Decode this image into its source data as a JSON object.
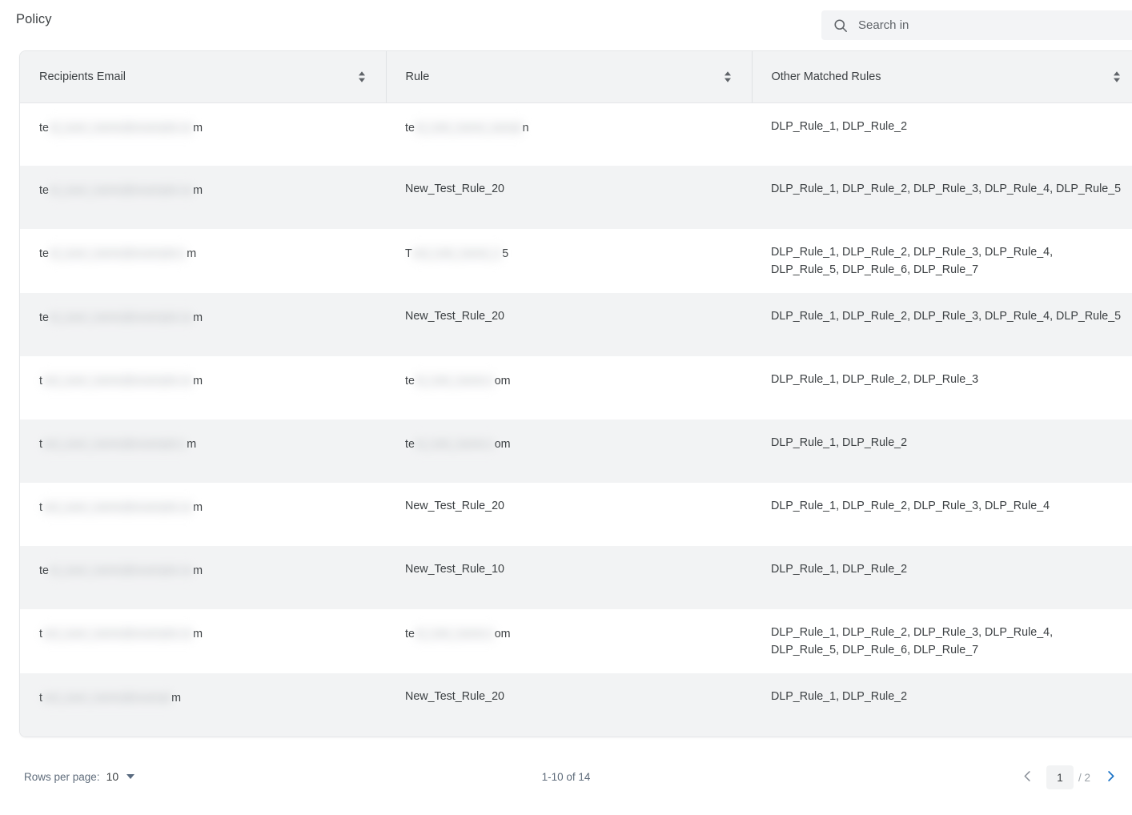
{
  "header": {
    "title": "Policy",
    "search": {
      "placeholder": "Search in",
      "value": "",
      "icon": "search-icon"
    }
  },
  "table": {
    "columns": [
      {
        "label": "Recipients Email",
        "sortable": true,
        "sort_icon": "sort-updown-icon"
      },
      {
        "label": "Rule",
        "sortable": true,
        "sort_icon": "sort-updown-icon"
      },
      {
        "label": "Other Matched Rules",
        "sortable": true,
        "sort_icon": "sort-updown-icon"
      }
    ],
    "rows": [
      {
        "email_prefix": "te",
        "email_redacted": "st_user_name@example.co",
        "email_suffix": "m",
        "rule_prefix": "te",
        "rule_redacted": "st_rule_name_sampl",
        "rule_suffix": "n",
        "rule_is_redacted": true,
        "rule": "",
        "other_matched_rules": "DLP_Rule_1, DLP_Rule_2"
      },
      {
        "email_prefix": "te",
        "email_redacted": "st_user_name@example.co",
        "email_suffix": "m",
        "rule_is_redacted": false,
        "rule": "New_Test_Rule_20",
        "other_matched_rules": "DLP_Rule_1, DLP_Rule_2, DLP_Rule_3, DLP_Rule_4, DLP_Rule_5"
      },
      {
        "email_prefix": "te",
        "email_redacted": "st_user_name@example.c",
        "email_suffix": "m",
        "rule_prefix": "T",
        "rule_redacted": "est_rule_name_1",
        "rule_suffix": "5",
        "rule_is_redacted": true,
        "rule": "",
        "other_matched_rules": "DLP_Rule_1, DLP_Rule_2, DLP_Rule_3, DLP_Rule_4, DLP_Rule_5, DLP_Rule_6, DLP_Rule_7"
      },
      {
        "email_prefix": "te",
        "email_redacted": "st_user_name@example.co",
        "email_suffix": "m",
        "rule_is_redacted": false,
        "rule": "New_Test_Rule_20",
        "other_matched_rules": "DLP_Rule_1, DLP_Rule_2, DLP_Rule_3, DLP_Rule_4, DLP_Rule_5"
      },
      {
        "email_prefix": "t",
        "email_redacted": "est_user_name@example.co",
        "email_suffix": "m",
        "rule_prefix": "te",
        "rule_redacted": "st_rule_name.c",
        "rule_suffix": "om",
        "rule_is_redacted": true,
        "rule": "",
        "other_matched_rules": "DLP_Rule_1, DLP_Rule_2, DLP_Rule_3"
      },
      {
        "email_prefix": "t",
        "email_redacted": "est_user_name@example.c",
        "email_suffix": "m",
        "rule_prefix": "te",
        "rule_redacted": "st_rule_name.c",
        "rule_suffix": "om",
        "rule_is_redacted": true,
        "rule": "",
        "other_matched_rules": "DLP_Rule_1, DLP_Rule_2"
      },
      {
        "email_prefix": "t",
        "email_redacted": "est_user_name@example.co",
        "email_suffix": "m",
        "rule_is_redacted": false,
        "rule": "New_Test_Rule_20",
        "other_matched_rules": "DLP_Rule_1, DLP_Rule_2, DLP_Rule_3, DLP_Rule_4"
      },
      {
        "email_prefix": "te",
        "email_redacted": "st_user_name@example.co",
        "email_suffix": "m",
        "rule_is_redacted": false,
        "rule": "New_Test_Rule_10",
        "other_matched_rules": "DLP_Rule_1, DLP_Rule_2"
      },
      {
        "email_prefix": "t",
        "email_redacted": "est_user_name@example.co",
        "email_suffix": "m",
        "rule_prefix": "te",
        "rule_redacted": "st_rule_name.c",
        "rule_suffix": "om",
        "rule_is_redacted": true,
        "rule": "",
        "other_matched_rules": "DLP_Rule_1, DLP_Rule_2, DLP_Rule_3, DLP_Rule_4, DLP_Rule_5, DLP_Rule_6, DLP_Rule_7"
      },
      {
        "email_prefix": "t",
        "email_redacted": "est_user_name@exampl",
        "email_suffix": "m",
        "rule_is_redacted": false,
        "rule": "New_Test_Rule_20",
        "other_matched_rules": "DLP_Rule_1, DLP_Rule_2"
      }
    ]
  },
  "footer": {
    "rows_per_page_label": "Rows per page:",
    "rows_per_page_value": "10",
    "range_text": "1-10 of 14",
    "current_page": "1",
    "total_pages": "/ 2",
    "prev_icon": "chevron-left-icon",
    "next_icon": "chevron-right-icon"
  },
  "colors": {
    "accent": "#1a73c7",
    "header_bg": "#f2f3f4",
    "row_alt_bg": "#f2f3f4",
    "text": "#3c4043",
    "muted": "#5f6c7b"
  }
}
